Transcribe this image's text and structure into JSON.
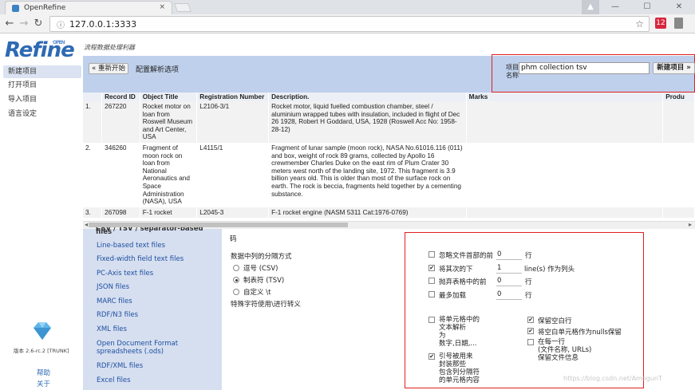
{
  "browser": {
    "tab_title": "OpenRefine",
    "close_glyph": "×",
    "url": "127.0.0.1:3333",
    "window_controls": [
      "—",
      "☐",
      "✕"
    ],
    "profile_glyph": "▲",
    "ext_label": "12"
  },
  "app": {
    "logo": "Refine",
    "logo_super": "OPEN",
    "subtitle": "流程数据处理利器"
  },
  "sidebar": {
    "items": [
      {
        "label": "新建项目"
      },
      {
        "label": "打开项目"
      },
      {
        "label": "导入项目"
      },
      {
        "label": "语言设定"
      }
    ],
    "version": "版本 2.6-rc.2 [TRUNK]",
    "help": "帮助",
    "about": "关于"
  },
  "header": {
    "restart_label": "« 重新开始",
    "config_title": "配置解析选项",
    "project_name_label": "项目名称",
    "project_name_value": "phm collection tsv",
    "create_label": "新建项目 »"
  },
  "preview": {
    "columns": [
      "",
      "Record ID",
      "Object Title",
      "Registration Number",
      "Description.",
      "Marks",
      "Produ"
    ],
    "rows": [
      {
        "idx": "1.",
        "id": "267220",
        "title": "Rocket motor on loan from Roswell Museum and Art Center, USA",
        "reg": "L2106-3/1",
        "desc": "Rocket motor, liquid fuelled combustion chamber, steel / aluminium wrapped tubes with insulation, included in flight of Dec 26 1928, Robert H Goddard, USA, 1928 (Roswell Acc No: 1958-28-12)"
      },
      {
        "idx": "2.",
        "id": "346260",
        "title": "Fragment of moon rock on loan from National Aeronautics and Space Administration (NASA), USA",
        "reg": "L4115/1",
        "desc": "Fragment of lunar sample (moon rock), NASA No.61016.116 (011) and box, weight of rock 89 grams, collected by Apollo 16 crewmember Charles Duke on the east rim of Plum Crater 30 meters west north of the landing site, 1972. This fragment is 3.9 billion years old. This is older than most of the surface rock on earth. The rock is beccia, fragments held together by a cementing substance."
      },
      {
        "idx": "3.",
        "id": "267098",
        "title": "F-1 rocket",
        "reg": "L2045-3",
        "desc": "F-1 rocket engine (NASM 5311 Cat:1976-0769)"
      }
    ]
  },
  "formats": {
    "cut_heading": "CSV / TSV / separator-based files",
    "items": [
      "Line-based text files",
      "Fixed-width field text files",
      "PC-Axis text files",
      "JSON files",
      "MARC files",
      "RDF/N3 files",
      "XML files",
      "Open Document Format spreadsheets (.ods)",
      "RDF/XML files",
      "Excel files"
    ]
  },
  "options": {
    "encoding_tail": "码",
    "separator_label": "数据中列的分隔方式",
    "radios": [
      {
        "label": "逗号 (CSV)",
        "checked": false
      },
      {
        "label": "制表符 (TSV)",
        "checked": true
      },
      {
        "label": "自定义 \\t",
        "checked": false
      }
    ],
    "escape_label": "特殊字符使用\\进行转义",
    "ignore_first_label": "忽略文件首部的前",
    "ignore_first_value": "0",
    "ignore_first_unit": "行",
    "header_lines_label": "将其次的下",
    "header_lines_value": "1",
    "header_lines_unit": "line(s) 作为列头",
    "discard_label": "抛弃表格中的前",
    "discard_value": "0",
    "discard_unit": "行",
    "load_max_label": "最多加载",
    "load_max_value": "0",
    "load_max_unit": "行",
    "parse_cell_lines": [
      "将单元格中的",
      "文本解析",
      "为",
      "数字,日期,..."
    ],
    "quote_lines": [
      "引号被用来",
      "封装那些",
      "包含列分隔符",
      "的单元格内容"
    ],
    "keep_blank_rows": "保留空白行",
    "store_blank_cells": "将空白单元格作为nulls保留",
    "per_row_lines": [
      "在每一行",
      "(文件名称, URLs)",
      "保留文件信息"
    ],
    "checks": {
      "ignore_first": false,
      "header_lines": true,
      "discard": false,
      "load_max": false,
      "parse_cell": false,
      "quote": true,
      "keep_blank_rows": true,
      "store_blank_cells": true,
      "per_row": false
    }
  },
  "watermark": "https://blog.csdn.net/AmogunT",
  "colors": {
    "accent": "#2e6ab3",
    "header_bar": "#bfd0ec",
    "highlight_box": "#e02020",
    "format_panel": "#d6dff0"
  }
}
